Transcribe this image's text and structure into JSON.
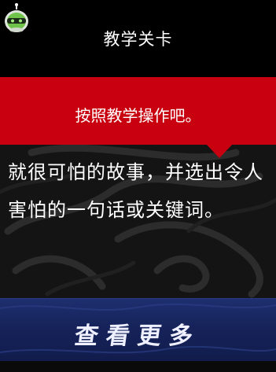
{
  "header": {
    "title": "教学关卡"
  },
  "banner": {
    "instruction": "按照教学操作吧。"
  },
  "content": {
    "text": "就很可怕的故事，并选出令人害怕的一句话或关键词。"
  },
  "more_button": {
    "label": "查看更多"
  },
  "colors": {
    "banner_red": "#c8000f",
    "button_blue": "#1a2a66",
    "robot_green": "#6fc24a"
  },
  "icons": {
    "top_left": "robot-icon"
  }
}
